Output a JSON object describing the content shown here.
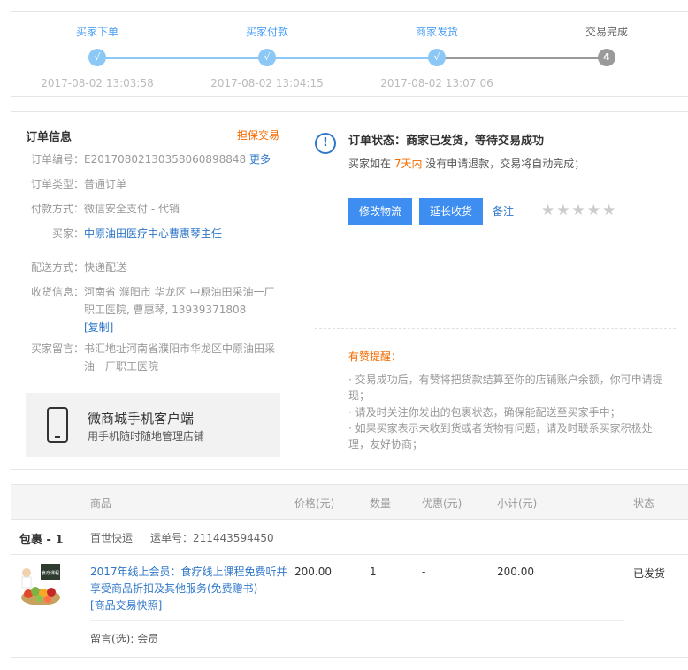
{
  "steps": [
    {
      "title": "买家下单",
      "time": "2017-08-02 13:03:58",
      "mark": "√",
      "done": true
    },
    {
      "title": "买家付款",
      "time": "2017-08-02 13:04:15",
      "mark": "√",
      "done": true
    },
    {
      "title": "商家发货",
      "time": "2017-08-02 13:07:06",
      "mark": "√",
      "done": true
    },
    {
      "title": "交易完成",
      "time": "",
      "mark": "4",
      "done": false
    }
  ],
  "order": {
    "title": "订单信息",
    "guarantee": "担保交易",
    "rows": [
      {
        "label": "订单编号：",
        "value": "E20170802130358060898848",
        "link": "更多"
      },
      {
        "label": "订单类型：",
        "value": "普通订单"
      },
      {
        "label": "付款方式：",
        "value": "微信安全支付 - 代销"
      },
      {
        "label": "买家：",
        "value": "中原油田医疗中心曹惠琴主任"
      }
    ],
    "delivery": {
      "label": "配送方式：",
      "value": "快递配送"
    },
    "address": {
      "label": "收货信息：",
      "value": "河南省 濮阳市 华龙区 中原油田采油一厂职工医院, 曹惠琴, 13939371808",
      "copy": "[复制]"
    },
    "message": {
      "label": "买家留言：",
      "value": "书汇地址河南省濮阳市华龙区中原油田采油一厂职工医院"
    },
    "app": {
      "title": "微商城手机客户端",
      "subtitle": "用手机随时随地管理店铺"
    }
  },
  "status": {
    "title": "订单状态：商家已发货，等待交易成功",
    "desc_prefix": "买家如在 ",
    "desc_highlight": "7天内",
    "desc_suffix": " 没有申请退款，交易将自动完成；",
    "btn_logistics": "修改物流",
    "btn_extend": "延长收货",
    "note": "备注",
    "star": "★",
    "rating": 0,
    "tips_title": "有赞提醒：",
    "tips": [
      "· 交易成功后，有赞将把货款结算至你的店铺账户余额，你可申请提现；",
      "· 请及时关注你发出的包裹状态，确保能配送至买家手中；",
      "· 如果买家表示未收到货或者货物有问题，请及时联系买家积极处理，友好协商；"
    ]
  },
  "goods": {
    "headers": {
      "product": "商品",
      "price": "价格(元)",
      "qty": "数量",
      "discount": "优惠(元)",
      "subtotal": "小计(元)",
      "status": "状态"
    },
    "package": {
      "name": "包裹 - 1",
      "express": "百世快运",
      "tracking": "运单号：211443594450"
    },
    "item": {
      "title": "2017年线上会员：食疗线上课程免费听并享受商品折扣及其他服务(免费赠书)",
      "snapshot": "[商品交易快照]",
      "price": "200.00",
      "qty": "1",
      "discount": "-",
      "subtotal": "200.00",
      "status": "已发货",
      "remark": "留言(选): 会员",
      "thumb_label": "食疗课程"
    }
  }
}
